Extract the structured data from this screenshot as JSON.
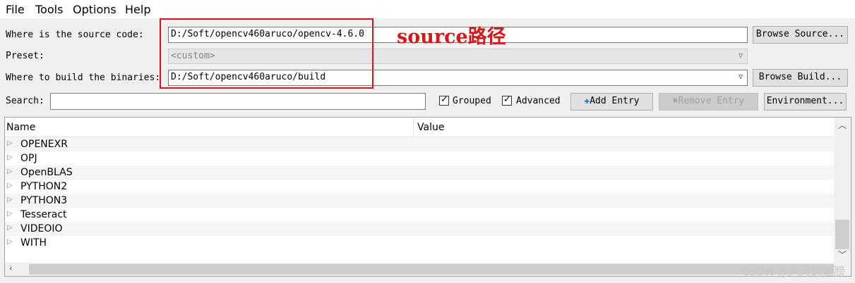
{
  "menu": {
    "file": "File",
    "tools": "Tools",
    "options": "Options",
    "help": "Help"
  },
  "source": {
    "label": "Where is the source code:",
    "value": "D:/Soft/opencv460aruco/opencv-4.6.0",
    "browse": "Browse Source..."
  },
  "preset": {
    "label": "Preset:",
    "value": "<custom>"
  },
  "build": {
    "label": "Where to build the binaries:",
    "value": "D:/Soft/opencv460aruco/build",
    "browse": "Browse Build..."
  },
  "search": {
    "label": "Search:",
    "value": ""
  },
  "options": {
    "grouped": "Grouped",
    "advanced": "Advanced",
    "add_entry": "Add Entry",
    "remove_entry": "Remove Entry",
    "environment": "Environment..."
  },
  "tree": {
    "col_name": "Name",
    "col_value": "Value",
    "rows": [
      "OPENEXR",
      "OPJ",
      "OpenBLAS",
      "PYTHON2",
      "PYTHON3",
      "Tesseract",
      "VIDEOIO",
      "WITH"
    ]
  },
  "annotation": "source路径",
  "watermark": "CSDN @六月的翅膀",
  "colors": {
    "annotation": "#d81818",
    "highlight_box": "#e0101a"
  }
}
